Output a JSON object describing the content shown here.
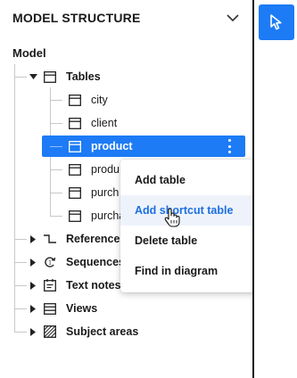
{
  "panel": {
    "title": "MODEL STRUCTURE",
    "root_label": "Model"
  },
  "tree": {
    "tables": {
      "label": "Tables",
      "children": [
        "city",
        "client",
        "product",
        "produ",
        "purch",
        "purcha"
      ]
    },
    "groups": [
      {
        "label": "References",
        "icon": "reference-icon"
      },
      {
        "label": "Sequences",
        "icon": "sequence-icon"
      },
      {
        "label": "Text notes",
        "icon": "text-note-icon"
      },
      {
        "label": "Views",
        "icon": "view-icon"
      },
      {
        "label": "Subject areas",
        "icon": "subject-area-icon"
      }
    ]
  },
  "context_menu": {
    "items": [
      "Add table",
      "Add shortcut table",
      "Delete table",
      "Find in diagram"
    ],
    "hovered": "Add shortcut table"
  },
  "colors": {
    "accent": "#1d7bf5",
    "hover_text": "#1d6fe0",
    "hover_bg": "#eef3fb"
  }
}
